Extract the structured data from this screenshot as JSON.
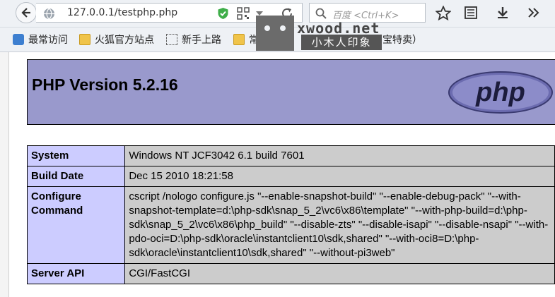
{
  "toolbar": {
    "url": "127.0.0.1/testphp.php",
    "search_placeholder": "百度 <Ctrl+K>"
  },
  "bookmarks": [
    {
      "label": "最常访问"
    },
    {
      "label": "火狐官方站点"
    },
    {
      "label": "新手上路"
    },
    {
      "label": "常"
    },
    {
      "label": "宝特卖）"
    }
  ],
  "watermark": {
    "domain": "xwood.net",
    "brand": "小木人印象"
  },
  "php": {
    "title": "PHP Version 5.2.16",
    "logo_text": "php",
    "rows": [
      {
        "key": "System",
        "value": "Windows NT JCF3042 6.1 build 7601"
      },
      {
        "key": "Build Date",
        "value": "Dec 15 2010 18:21:58"
      },
      {
        "key": "Configure Command",
        "value": "cscript /nologo configure.js \"--enable-snapshot-build\" \"--enable-debug-pack\" \"--with-snapshot-template=d:\\php-sdk\\snap_5_2\\vc6\\x86\\template\" \"--with-php-build=d:\\php-sdk\\snap_5_2\\vc6\\x86\\php_build\" \"--disable-zts\" \"--disable-isapi\" \"--disable-nsapi\" \"--with-pdo-oci=D:\\php-sdk\\oracle\\instantclient10\\sdk,shared\" \"--with-oci8=D:\\php-sdk\\oracle\\instantclient10\\sdk,shared\" \"--without-pi3web\""
      },
      {
        "key": "Server API",
        "value": "CGI/FastCGI"
      }
    ]
  },
  "icons": [
    "back-arrow-icon",
    "globe-icon",
    "shield-icon",
    "qr-code-icon",
    "dropdown-icon",
    "reload-icon",
    "search-icon",
    "star-icon",
    "reader-icon",
    "download-icon",
    "overflow-icon"
  ],
  "colors": {
    "php_header": "#9999cc",
    "key_cell": "#ccccff",
    "value_cell": "#cccccc"
  }
}
